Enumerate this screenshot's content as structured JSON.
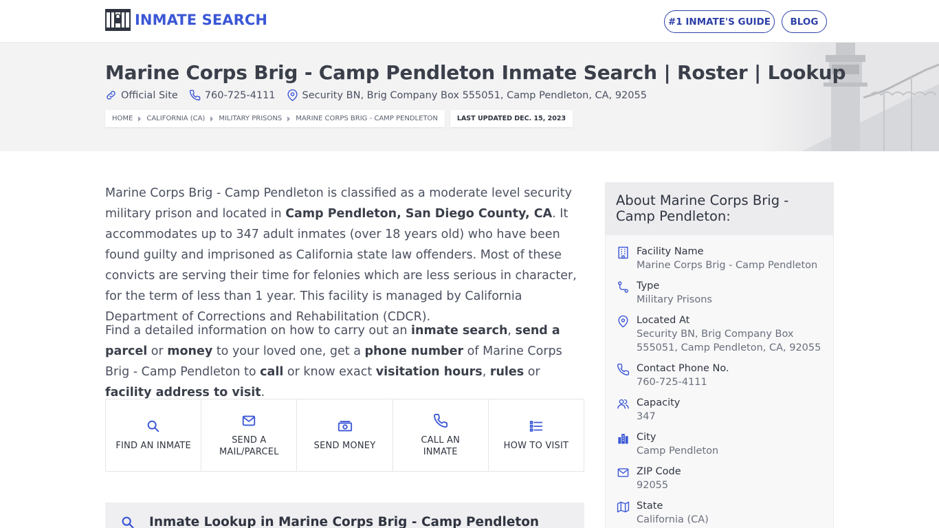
{
  "header": {
    "logo_text": "INMATE SEARCH",
    "nav": [
      {
        "label": "#1 INMATE'S GUIDE"
      },
      {
        "label": "BLOG"
      }
    ]
  },
  "hero": {
    "title": "Marine Corps Brig - Camp Pendleton Inmate Search | Roster | Lookup",
    "meta": {
      "official_site": "Official Site",
      "phone": "760-725-4111",
      "address": "Security BN, Brig Company Box 555051, Camp Pendleton, CA, 92055"
    },
    "breadcrumbs": [
      "HOME",
      "CALIFORNIA (CA)",
      "MILITARY PRISONS",
      "MARINE CORPS BRIG - CAMP PENDLETON"
    ],
    "last_updated": "LAST UPDATED DEC. 15, 2023"
  },
  "intro": {
    "p1_a": "Marine Corps Brig - Camp Pendleton is classified as a moderate level security military prison and located in ",
    "p1_b": "Camp Pendleton, San Diego County, CA",
    "p1_c": ". It accommodates up to 347 adult inmates (over 18 years old) who have been found guilty and imprisoned as California state law offenders. Most of these convicts are serving their time for felonies which are less serious in character, for the term of less than 1 year. This facility is managed by California Department of Corrections and Rehabilitation (CDCR).",
    "p2_a": "Find a detailed information on how to carry out an ",
    "p2_b": "inmate search",
    "p2_c": ", ",
    "p2_d": "send a parcel",
    "p2_e": " or ",
    "p2_f": "money",
    "p2_g": " to your loved one, get a ",
    "p2_h": "phone number",
    "p2_i": " of Marine Corps Brig - Camp Pendleton to ",
    "p2_j": "call",
    "p2_k": " or know exact ",
    "p2_l": "visitation hours",
    "p2_m": ", ",
    "p2_n": "rules",
    "p2_o": " or ",
    "p2_p": "facility address to visit",
    "p2_q": "."
  },
  "actions": [
    {
      "line1": "FIND AN INMATE",
      "line2": "",
      "icon": "search-icon"
    },
    {
      "line1": "SEND A",
      "line2": "MAIL/PARCEL",
      "icon": "mail-icon"
    },
    {
      "line1": "SEND MONEY",
      "line2": "",
      "icon": "money-icon"
    },
    {
      "line1": "CALL AN",
      "line2": "INMATE",
      "icon": "phone-icon"
    },
    {
      "line1": "HOW TO VISIT",
      "line2": "",
      "icon": "list-icon"
    }
  ],
  "lookup": {
    "title": "Inmate Lookup in Marine Corps Brig - Camp Pendleton"
  },
  "about": {
    "heading": "About Marine Corps Brig - Camp Pendleton:",
    "rows": [
      {
        "label": "Facility Name",
        "value": "Marine Corps Brig - Camp Pendleton",
        "icon": "building-icon"
      },
      {
        "label": "Type",
        "value": "Military Prisons",
        "icon": "route-icon"
      },
      {
        "label": "Located At",
        "value": "Security BN, Brig Company Box 555051, Camp Pendleton, CA, 92055",
        "icon": "location-pin-icon"
      },
      {
        "label": "Contact Phone No.",
        "value": "760-725-4111",
        "icon": "phone-icon"
      },
      {
        "label": "Capacity",
        "value": "347",
        "icon": "users-icon"
      },
      {
        "label": "City",
        "value": "Camp Pendleton",
        "icon": "city-icon"
      },
      {
        "label": "ZIP Code",
        "value": "92055",
        "icon": "mail-icon"
      },
      {
        "label": "State",
        "value": "California (CA)",
        "icon": "map-icon"
      }
    ]
  },
  "colors": {
    "brand": "#3b57d6",
    "nav_border": "#2d3fa8",
    "text": "#3f4656",
    "hero_bg": "#f3f3f4"
  }
}
